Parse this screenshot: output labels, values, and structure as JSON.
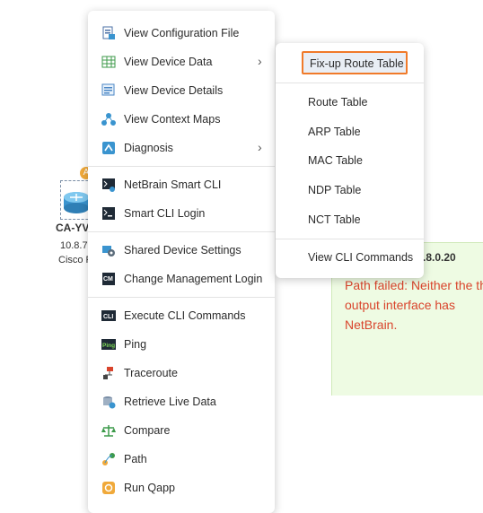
{
  "device": {
    "badge": "A",
    "name": "CA-YV",
    "ip": "10.8.7",
    "vendor": "Cisco R"
  },
  "path_panel": {
    "ip_text": ".8.0.20",
    "message": "Path failed: Neither the the output interface has NetBrain."
  },
  "menu": {
    "items": [
      {
        "label": "View Configuration File",
        "icon": "config-file-icon"
      },
      {
        "label": "View Device Data",
        "icon": "table-grid-icon"
      },
      {
        "label": "View Device Details",
        "icon": "device-details-icon"
      },
      {
        "label": "View Context Maps",
        "icon": "context-map-icon"
      },
      {
        "label": "Diagnosis",
        "icon": "diagnosis-icon"
      },
      {
        "label": "NetBrain Smart CLI",
        "icon": "smart-cli-icon"
      },
      {
        "label": "Smart CLI Login",
        "icon": "terminal-login-icon"
      },
      {
        "label": "Shared Device Settings",
        "icon": "shared-settings-icon"
      },
      {
        "label": "Change Management Login",
        "icon": "change-management-icon"
      },
      {
        "label": "Execute CLI Commands",
        "icon": "cli-icon"
      },
      {
        "label": "Ping",
        "icon": "ping-icon"
      },
      {
        "label": "Traceroute",
        "icon": "traceroute-icon"
      },
      {
        "label": "Retrieve Live Data",
        "icon": "live-data-icon"
      },
      {
        "label": "Compare",
        "icon": "compare-scale-icon"
      },
      {
        "label": "Path",
        "icon": "path-icon"
      },
      {
        "label": "Run Qapp",
        "icon": "qapp-icon"
      }
    ],
    "cli_icon_text": "CLI",
    "ping_icon_text": "Ping",
    "cm_icon_text": "CM"
  },
  "submenu": {
    "items": [
      {
        "label": "Fix-up Route Table"
      },
      {
        "label": "Route Table"
      },
      {
        "label": "ARP Table"
      },
      {
        "label": "MAC Table"
      },
      {
        "label": "NDP Table"
      },
      {
        "label": "NCT Table"
      },
      {
        "label": "View CLI Commands"
      }
    ]
  },
  "colors": {
    "highlight_border": "#f07a2a",
    "error_text": "#d9442c",
    "panel_bg": "#eefbe3"
  }
}
